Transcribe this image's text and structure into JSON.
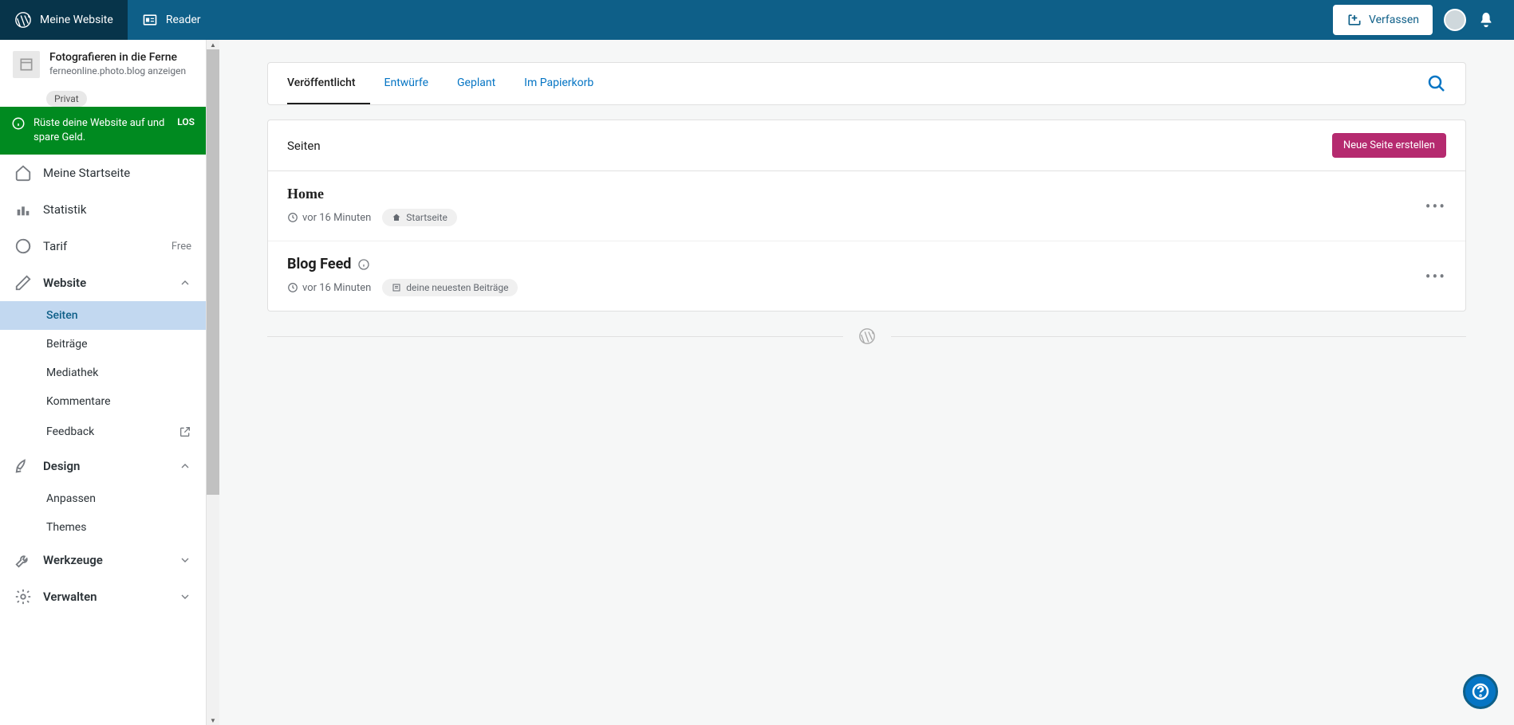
{
  "topbar": {
    "my_site": "Meine Website",
    "reader": "Reader",
    "compose": "Verfassen"
  },
  "site": {
    "name": "Fotografieren in die Ferne",
    "url": "ferneonline.photo.blog anzeigen",
    "privacy": "Privat"
  },
  "promo": {
    "text": "Rüste deine Website auf und spare Geld.",
    "action": "LOS"
  },
  "nav": {
    "home": "Meine Startseite",
    "stats": "Statistik",
    "plan": "Tarif",
    "plan_badge": "Free",
    "website": "Website",
    "site_items": {
      "pages": "Seiten",
      "posts": "Beiträge",
      "media": "Mediathek",
      "comments": "Kommentare",
      "feedback": "Feedback"
    },
    "design": "Design",
    "design_items": {
      "customize": "Anpassen",
      "themes": "Themes"
    },
    "tools": "Werkzeuge",
    "manage": "Verwalten"
  },
  "tabs": {
    "published": "Veröffentlicht",
    "drafts": "Entwürfe",
    "scheduled": "Geplant",
    "trash": "Im Papierkorb"
  },
  "list": {
    "title": "Seiten",
    "new_button": "Neue Seite erstellen"
  },
  "pages": [
    {
      "title": "Home",
      "time": "vor 16 Minuten",
      "badge": "Startseite",
      "icon": "home"
    },
    {
      "title": "Blog Feed",
      "time": "vor 16 Minuten",
      "badge": "deine neuesten Beiträge",
      "icon": "posts",
      "info": true
    }
  ]
}
